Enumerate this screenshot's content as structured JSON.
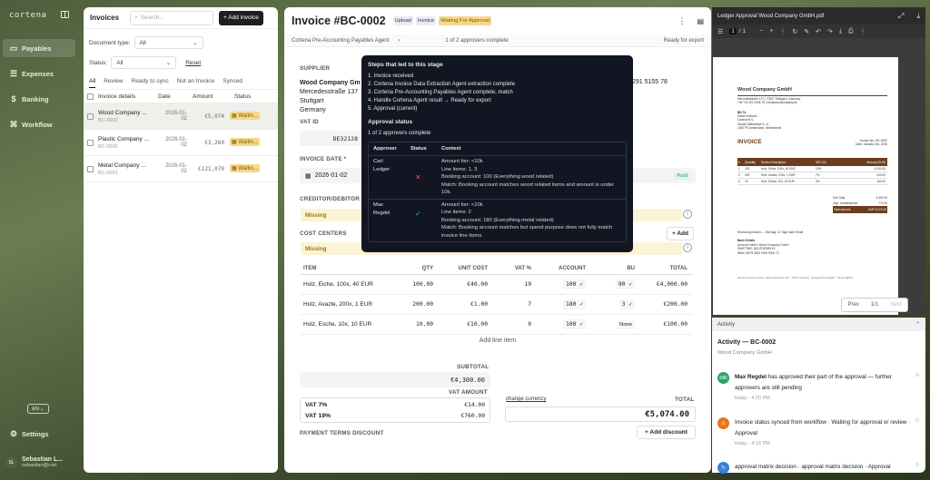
{
  "app": {
    "brand": "cortena"
  },
  "nav": [
    {
      "label": "Payables"
    },
    {
      "label": "Expenses"
    },
    {
      "label": "Banking"
    },
    {
      "label": "Workflow"
    }
  ],
  "settings": "Settings",
  "language": "EN",
  "user": {
    "name": "Sebastian L...",
    "email": "sebastian@cort",
    "initials": "SL"
  },
  "invoices": {
    "title": "Invoices",
    "search_placeholder": "Search...",
    "add_label": "+ Add invoice",
    "doc_type_label": "Document type:",
    "doc_type_value": "All",
    "status_label": "Status:",
    "status_value": "All",
    "reset": "Reset",
    "tabs": [
      "All",
      "Review",
      "Ready to sync",
      "Not an Invoice",
      "Synced"
    ],
    "columns": [
      "Invoice details",
      "Date",
      "Amount",
      "Status"
    ],
    "rows": [
      {
        "name": "Wood Company ...",
        "id": "BC-0002",
        "date1": "2026-01-",
        "date2": "02",
        "amount": "€5,074",
        "status": "Waitin..."
      },
      {
        "name": "Plastic Company ...",
        "id": "BC-0002",
        "date1": "2026-01-",
        "date2": "02",
        "amount": "€3,260",
        "status": "Waitin..."
      },
      {
        "name": "Metal Company ...",
        "id": "BC-0001",
        "date1": "2026-01-",
        "date2": "02",
        "amount": "€121,070",
        "status": "Waitin..."
      }
    ]
  },
  "detail": {
    "title": "Invoice #BC-0002",
    "tags": [
      "Upload",
      "Invoice",
      "Waiting For Approval"
    ],
    "crumb": {
      "agent": "Cortena Pre-Accounting Payables Agent",
      "approvers": "1 of 2 approvers complete",
      "export": "Ready for export"
    },
    "supplier_label": "SUPPLIER",
    "supplier_name": "Wood Company Gm",
    "supplier_street": "Mercedesstraße 137",
    "supplier_city": "Stuttgart",
    "supplier_country": "Germany",
    "phone": "291 5155 78",
    "vat_label": "VAT ID",
    "vat_value": "DE32128",
    "date_label": "INVOICE DATE *",
    "date_value": "2026-01-02",
    "paid": "Paid",
    "creditor_label": "CREDITOR/DEBITOR",
    "missing": "Missing",
    "cost_label": "COST CENTERS",
    "add": "+ Add",
    "item_cols": [
      "ITEM",
      "QTY",
      "UNIT COST",
      "VAT %",
      "ACCOUNT",
      "BU",
      "TOTAL"
    ],
    "items": [
      {
        "item": "Holz, Eiche, 100x, 40 EUR",
        "qty": "100.00",
        "unit": "€40.00",
        "vat": "19",
        "account": "100 ✓",
        "bu": "90 ✓",
        "total": "€4,000.00"
      },
      {
        "item": "Holz, Avazle, 200x, 1 EUR",
        "qty": "200.00",
        "unit": "€1.00",
        "vat": "7",
        "account": "180 ✓",
        "bu": "3 ✓",
        "total": "€200.00"
      },
      {
        "item": "Holz, Esche, 10x, 10 EUR",
        "qty": "10.00",
        "unit": "€10.00",
        "vat": "0",
        "account": "100 ✓",
        "bu": "None",
        "total": "€100.00"
      }
    ],
    "add_line": "Add line item",
    "subtotal_label": "SUBTOTAL",
    "subtotal": "€4,300.00",
    "vat_amount_label": "VAT AMOUNT",
    "vat7_label": "VAT 7%",
    "vat7": "€14.00",
    "vat19_label": "VAT 19%",
    "vat19": "€760.00",
    "change_currency": "change currency",
    "total_label": "TOTAL",
    "total": "€5,074.00",
    "payment_terms": "PAYMENT TERMS DISCOUNT",
    "add_discount": "+ Add discount"
  },
  "tooltip": {
    "steps_title": "Steps that led to this stage",
    "steps": [
      "1. Invoice received",
      "2. Cortena Invoice Data Extraction Agent extraction complete",
      "3. Cortena Pre-Accounting Payables Agent complete, match",
      "4. Handle Cortena Agent result → Ready for export",
      "5. Approval (current)"
    ],
    "approval_title": "Approval status",
    "approval_sub": "1 of 2 approvers complete",
    "cols": [
      "Approver",
      "Status",
      "Context"
    ],
    "approvers": [
      {
        "name1": "Carl",
        "name2": "Ledger",
        "status": "✕",
        "status_color": "#e05252",
        "context": [
          "Amount tier: <10k",
          "Line items: 1, 3",
          "Booking account: 100 (Everything wood related)",
          "Match: Booking account matches wood related items and amount is under 10k."
        ]
      },
      {
        "name1": "Max",
        "name2": "Regdel",
        "status": "✓",
        "status_color": "#3cc87a",
        "context": [
          "Amount tier: <10k",
          "Line items: 2",
          "Booking account: 180 (Everything metal related)",
          "Match: Booking account matches but spend purpose does not fully match invoice line items."
        ]
      }
    ]
  },
  "pdf": {
    "filename": "Ledger Approval Wood Company GmbH.pdf",
    "page": "1",
    "pages": "/ 1",
    "doc": {
      "company": "Wood Company GmbH",
      "addr1": "Mercedesstraße 137 | 70327 Stuttgart | Germany",
      "addr2": "+49 711 291 5155 78 | info@woodcompany.de",
      "billto": "Bill To",
      "b1": "Sarah Johnson",
      "b2": "Cortena B.V.",
      "b3": "Gustav Mahlerlaan 5 - 6",
      "b4": "1082 PS Amsterdam, Netherlands",
      "heading": "INVOICE",
      "inv_no": "Invoice No.: BC-0002",
      "inv_date": "Date: January 2nd, 2026",
      "cols": [
        "#",
        "Quantity",
        "Service Description",
        "VAT (%)",
        "Amount (EUR)"
      ],
      "rows": [
        [
          "1",
          "100",
          "Holz, Eiche, 100x, 40 EUR",
          "19%",
          "4,000.00"
        ],
        [
          "2",
          "200",
          "Holz, Akazie, 200x, 1 EUR",
          "7%",
          "200.00"
        ],
        [
          "3",
          "10",
          "Holz, Esche, 10x, 10 EUR",
          "0%",
          "100.00"
        ]
      ],
      "sub_l": "Sub Total",
      "sub_v": "4,300.00",
      "vat_l": "Zzgl. Umsatzsteuer",
      "vat_v": "774.00",
      "tot_l": "Total Amount",
      "tot_v": "EUR 5,074.00",
      "pay": "Rechnung bezahlt — Stichtag: 14 Tage nach Erhalt",
      "bank_h": "Bank Details",
      "bank1": "Account Holder: Wood Company GmbH",
      "bank2": "SWIFT/BIC: DEUTDEDBXXX",
      "bank3": "IBAN: DE75 5502 0000 9000 73",
      "footer": "Wood Company GmbH · Mercedesstraße 137 · 70327 Stuttgart · Amtsgericht Stuttgart · USt-ID DE321"
    },
    "prev": "Prev",
    "pager": "1/1",
    "next": "Next"
  },
  "activity": {
    "header": "Activity",
    "title": "Activity — BC-0002",
    "subtitle": "Wood Company GmbH",
    "events": [
      {
        "initials": "MR",
        "color": "#2aa368",
        "text": "has approved their part of the approval — further approvers are still pending",
        "bold": "Max Regdel",
        "date": "today · 4:20 PM"
      },
      {
        "initials": "⚠",
        "color": "#e8741e",
        "text": "Invoice status synced from workflow · Waiting for approval or review · Approval",
        "bold": "",
        "date": "today · 4:16 PM"
      },
      {
        "initials": "↻",
        "color": "#3b7dd8",
        "text": "approval matrix decision · approval matrix decision · Approval",
        "bold": "",
        "date": ""
      }
    ]
  }
}
